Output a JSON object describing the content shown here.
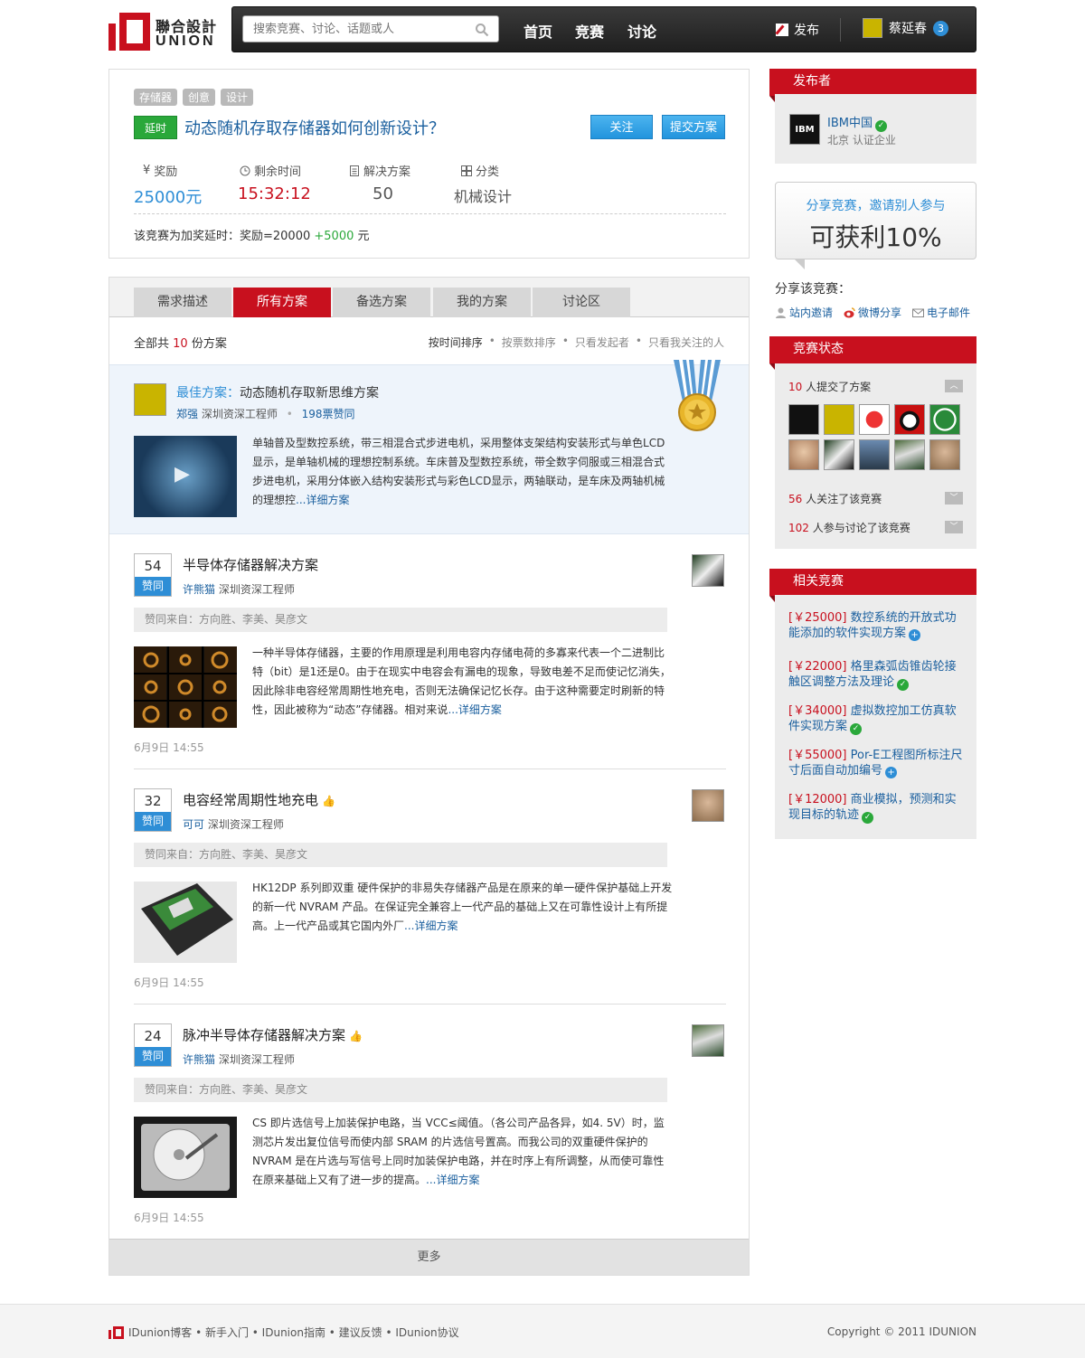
{
  "header": {
    "logo_cn": "聯合設計",
    "logo_en": "UNION",
    "search_placeholder": "搜索竞赛、讨论、话题或人",
    "nav": [
      "首页",
      "竞赛",
      "讨论"
    ],
    "publish": "发布",
    "user": "蔡延春",
    "user_badge": "3"
  },
  "competition": {
    "tags": [
      "存储器",
      "创意",
      "设计"
    ],
    "delay_label": "延时",
    "title": "动态随机存取存储器如何创新设计？",
    "follow": "关注",
    "submit": "提交方案",
    "stats": [
      {
        "label": "奖励",
        "prefix": "¥",
        "value": "25000元"
      },
      {
        "label": "剩余时间",
        "value": "15:32:12"
      },
      {
        "label": "解决方案",
        "value": "50"
      },
      {
        "label": "分类",
        "value": "机械设计"
      }
    ],
    "note_prefix": "该竞赛为加奖延时：奖励=20000",
    "note_bonus": "+5000",
    "note_suffix": "元"
  },
  "tabs": [
    "需求描述",
    "所有方案",
    "备选方案",
    "我的方案",
    "讨论区"
  ],
  "solutions_header": {
    "total_prefix": "全部共",
    "total_count": "10",
    "total_suffix": "份方案",
    "sort": [
      "按时间排序",
      "按票数排序",
      "只看发起者",
      "只看我关注的人"
    ]
  },
  "best": {
    "label": "最佳方案",
    "title": "动态随机存取新思维方案",
    "author": "郑强",
    "role": "深圳资深工程师",
    "votes": "198票赞同",
    "text": "单轴普及型数控系统，带三相混合式步进电机，采用整体支架结构安装形式与单色LCD显示，是单轴机械的理想控制系统。车床普及型数控系统，带全数字伺服或三相混合式步进电机，采用分体嵌入结构安装形式与彩色LCD显示，两轴联动，是车床及两轴机械的理想控",
    "more": "...详细方案"
  },
  "items": [
    {
      "votes": "54",
      "vote_label": "赞同",
      "title": "半导体存储器解决方案",
      "thumb": false,
      "author": "许熊猫",
      "role": "深圳资深工程师",
      "agree": "赞同来自：方向胜、李美、昊彦文",
      "text": "一种半导体存储器，主要的作用原理是利用电容内存储电荷的多寡来代表一个二进制比特（bit）是1还是0。由于在现实中电容会有漏电的现象，导致电差不足而使记忆消失，因此除非电容经常周期性地充电，否则无法确保记忆长存。由于这种需要定时刷新的特性，因此被称为“动态”存储器。相对来说",
      "more": "...详细方案",
      "date": "6月9日 14:55"
    },
    {
      "votes": "32",
      "vote_label": "赞同",
      "title": "电容经常周期性地充电",
      "thumb": true,
      "author": "可可",
      "role": "深圳资深工程师",
      "agree": "赞同来自：方向胜、李美、昊彦文",
      "text": "HK12DP 系列即双重 硬件保护的非易失存储器产品是在原来的单一硬件保护基础上开发的新一代 NVRAM 产品。在保证完全兼容上一代产品的基础上又在可靠性设计上有所提高。上一代产品或其它国内外厂",
      "more": "...详细方案",
      "date": "6月9日 14:55"
    },
    {
      "votes": "24",
      "vote_label": "赞同",
      "title": "脉冲半导体存储器解决方案",
      "thumb": true,
      "author": "许熊猫",
      "role": "深圳资深工程师",
      "agree": "赞同来自：方向胜、李美、昊彦文",
      "text": "CS 即片选信号上加装保护电路，当 VCC≤阈值。（各公司产品各异，如4. 5V）时，监测芯片发出复位信号而使内部 SRAM 的片选信号置高。而我公司的双重硬件保护的 NVRAM 是在片选与写信号上同时加装保护电路，并在时序上有所调整，从而使可靠性在原来基础上又有了进一步的提高。",
      "more": "...详细方案",
      "date": "6月9日 14:55"
    }
  ],
  "more_label": "更多",
  "sidebar": {
    "publisher_head": "发布者",
    "publisher_name": "IBM中国",
    "publisher_loc": "北京 认证企业",
    "share_line1": "分享竞赛，邀请别人参与",
    "share_line2": "可获利10%",
    "share_label": "分享该竞赛：",
    "share_links": [
      "站内邀请",
      "微博分享",
      "电子邮件"
    ],
    "status_head": "竞赛状态",
    "submitted_count": "10",
    "submitted_text": "人提交了方案",
    "followed_count": "56",
    "followed_text": "人关注了该竞赛",
    "discussed_count": "102",
    "discussed_text": "人参与讨论了该竞赛",
    "related_head": "相关竞赛",
    "related": [
      {
        "prize": "[￥25000]",
        "title": "数控系统的开放式功能添加的软件实现方案",
        "icon": "plus"
      },
      {
        "prize": "[￥22000]",
        "title": "格里森弧齿锥齿轮接触区调整方法及理论",
        "icon": "check"
      },
      {
        "prize": "[￥34000]",
        "title": "虚拟数控加工仿真软件实现方案",
        "icon": "check"
      },
      {
        "prize": "[￥55000]",
        "title": "Por-E工程图所标注尺寸后面自动加编号",
        "icon": "plus"
      },
      {
        "prize": "[￥12000]",
        "title": "商业模拟，预测和实现目标的轨迹",
        "icon": "check"
      }
    ]
  },
  "footer": {
    "links": "IDunion博客 • 新手入门 • IDunion指南 • 建议反馈 • IDunion协议",
    "copyright": "Copyright © 2011 IDUNION"
  },
  "colors": {
    "brand": "#c8101e",
    "link": "#1a5f9e",
    "accent": "#2e8ed6",
    "success": "#2aa83a"
  }
}
